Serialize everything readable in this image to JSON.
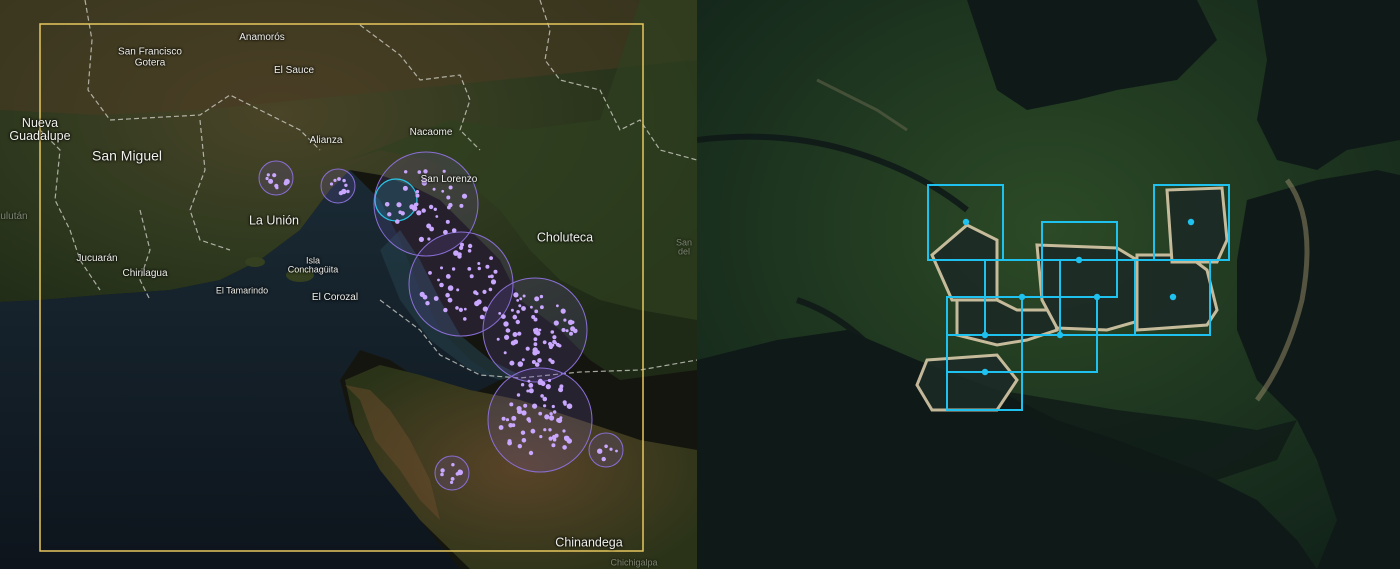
{
  "left_map": {
    "selection_color": "#e7c75e",
    "cluster_color": "#8a6fd6",
    "point_color": "#c9a7ff",
    "highlight_color": "#29c3e6",
    "labels": {
      "san_francisco_gotera": "San Francisco\nGotera",
      "anamoros": "Anamorós",
      "el_sauce": "El Sauce",
      "nueva_guadalupe": "Nueva\nGuadalupe",
      "san_miguel": "San Miguel",
      "alianza": "Alianza",
      "nacaome": "Nacaome",
      "san_lorenzo": "San Lorenzo",
      "la_union": "La Unión",
      "choluteca": "Choluteca",
      "jucuaran": "Jucuarán",
      "chirilagua": "Chirilagua",
      "isla_conchaguita": "Isla\nConchagüita",
      "el_tamarindo": "El Tamarindo",
      "el_corozal": "El Corozal",
      "chinandega": "Chinandega",
      "sultan_partial": "ulután",
      "san_partial": "San\ndel",
      "chichigalpa_partial": "Chichigalpa"
    }
  },
  "right_map": {
    "box_color": "#1fc2ee",
    "tile_count": 10
  }
}
